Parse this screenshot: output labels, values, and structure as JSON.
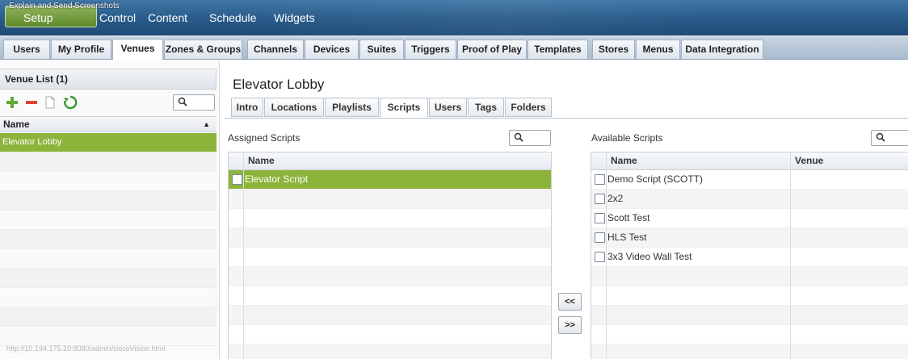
{
  "topbar": {
    "overlay_label": "Explain and Send Screenshots",
    "setup_label": "Setup",
    "control_label": "Control",
    "nav": [
      "Content",
      "Schedule",
      "Widgets"
    ]
  },
  "main_tabs": [
    {
      "label": "Users",
      "active": false
    },
    {
      "label": "My Profile",
      "active": false
    },
    {
      "label": "Venues",
      "active": true
    },
    {
      "label": "Zones & Groups",
      "active": false
    },
    {
      "label": "Channels",
      "active": false
    },
    {
      "label": "Devices",
      "active": false
    },
    {
      "label": "Suites",
      "active": false
    },
    {
      "label": "Triggers",
      "active": false
    },
    {
      "label": "Proof of Play",
      "active": false
    },
    {
      "label": "Templates",
      "active": false
    },
    {
      "label": "Stores",
      "active": false
    },
    {
      "label": "Menus",
      "active": false
    },
    {
      "label": "Data Integration",
      "active": false
    }
  ],
  "venue_list": {
    "header": "Venue List (1)",
    "column_name": "Name",
    "sort_indicator": "▲",
    "items": [
      "Elevator Lobby"
    ],
    "toolbar_icons": [
      "add-icon",
      "remove-icon",
      "copy-icon",
      "refresh-icon"
    ]
  },
  "status_url": "http://10.194.175.20:8080/admin/ciscoVision.html",
  "content": {
    "venue_title": "Elevator Lobby",
    "subtabs": [
      {
        "label": "Intro",
        "active": false
      },
      {
        "label": "Locations",
        "active": false
      },
      {
        "label": "Playlists",
        "active": false
      },
      {
        "label": "Scripts",
        "active": true
      },
      {
        "label": "Users",
        "active": false
      },
      {
        "label": "Tags",
        "active": false
      },
      {
        "label": "Folders",
        "active": false
      }
    ],
    "assigned": {
      "label": "Assigned Scripts",
      "column_name": "Name",
      "rows": [
        "Elevator Script"
      ]
    },
    "available": {
      "label": "Available Scripts",
      "column_name": "Name",
      "column_venue": "Venue",
      "rows": [
        "Demo Script (SCOTT)",
        "2x2",
        "Scott Test",
        "HLS Test",
        "3x3 Video Wall Test"
      ]
    },
    "move_left_label": "<<",
    "move_right_label": ">>"
  },
  "colors": {
    "selection_green": "#8cb43a",
    "topbar_blue": "#285a89",
    "setup_green": "#6f9a36"
  }
}
